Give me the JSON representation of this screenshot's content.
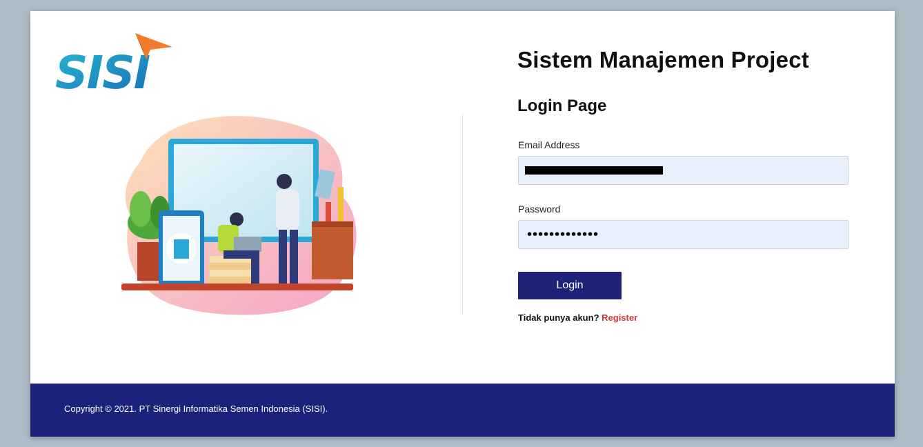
{
  "brand": {
    "logo_text": "SISI",
    "primary_color": "#1c227a",
    "accent_color": "#d0393d"
  },
  "header": {
    "title": "Sistem Manajemen Project"
  },
  "form": {
    "heading": "Login Page",
    "email_label": "Email Address",
    "email_value": "",
    "password_label": "Password",
    "password_value": "•••••••••••••",
    "login_label": "Login",
    "register_prompt": "Tidak punya akun?",
    "register_link": "Register"
  },
  "footer": {
    "copyright": "Copyright © 2021. PT Sinergi Informatika Semen Indonesia (SISI)."
  }
}
